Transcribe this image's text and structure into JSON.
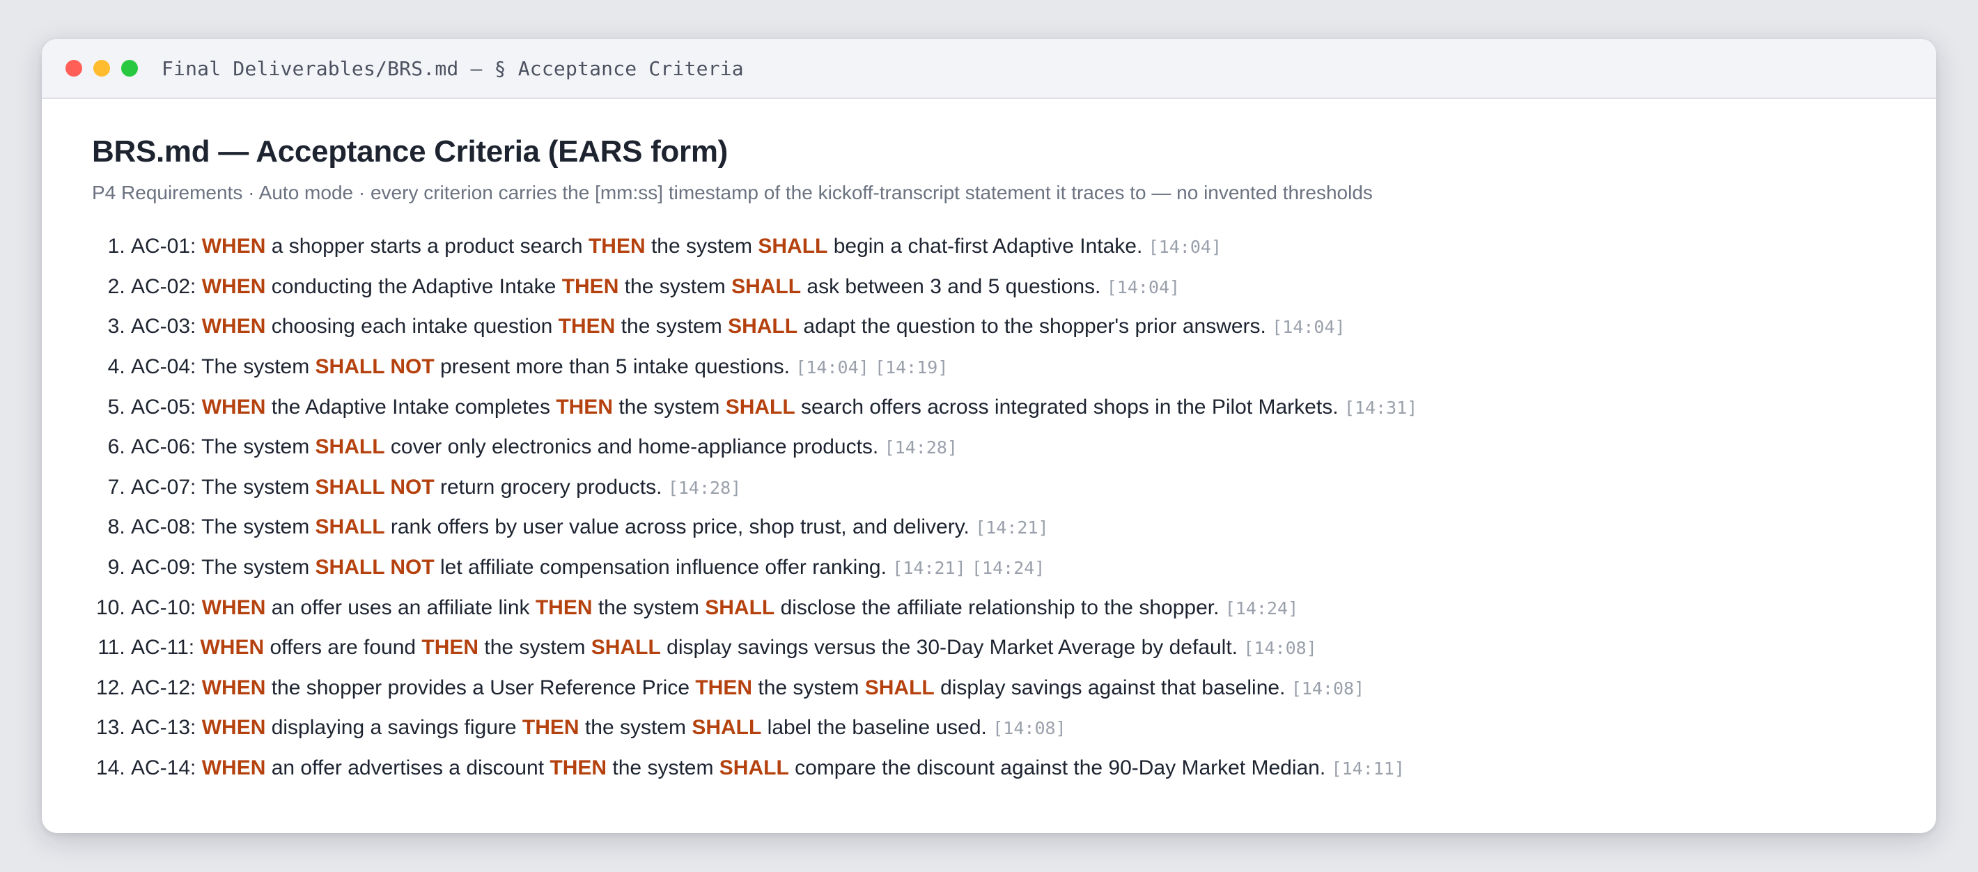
{
  "window": {
    "title": "Final Deliverables/BRS.md — § Acceptance Criteria"
  },
  "page": {
    "title": "BRS.md — Acceptance Criteria (EARS form)",
    "subtitle": "P4 Requirements · Auto mode · every criterion carries the [mm:ss] timestamp of the kickoff-transcript statement it traces to — no invented thresholds"
  },
  "colors": {
    "keyword": "#b5420e",
    "timestamp": "#9aa0ab",
    "text": "#1d2430"
  },
  "criteria": [
    {
      "segments": [
        {
          "t": "AC-01: "
        },
        {
          "t": "WHEN",
          "k": true
        },
        {
          "t": " a shopper starts a product search "
        },
        {
          "t": "THEN",
          "k": true
        },
        {
          "t": " the system "
        },
        {
          "t": "SHALL",
          "k": true
        },
        {
          "t": " begin a chat-first Adaptive Intake."
        }
      ],
      "timestamps": [
        "[14:04]"
      ]
    },
    {
      "segments": [
        {
          "t": "AC-02: "
        },
        {
          "t": "WHEN",
          "k": true
        },
        {
          "t": " conducting the Adaptive Intake "
        },
        {
          "t": "THEN",
          "k": true
        },
        {
          "t": " the system "
        },
        {
          "t": "SHALL",
          "k": true
        },
        {
          "t": " ask between 3 and 5 questions."
        }
      ],
      "timestamps": [
        "[14:04]"
      ]
    },
    {
      "segments": [
        {
          "t": "AC-03: "
        },
        {
          "t": "WHEN",
          "k": true
        },
        {
          "t": " choosing each intake question "
        },
        {
          "t": "THEN",
          "k": true
        },
        {
          "t": " the system "
        },
        {
          "t": "SHALL",
          "k": true
        },
        {
          "t": " adapt the question to the shopper's prior answers."
        }
      ],
      "timestamps": [
        "[14:04]"
      ]
    },
    {
      "segments": [
        {
          "t": "AC-04: The system "
        },
        {
          "t": "SHALL NOT",
          "k": true
        },
        {
          "t": " present more than 5 intake questions."
        }
      ],
      "timestamps": [
        "[14:04]",
        "[14:19]"
      ]
    },
    {
      "segments": [
        {
          "t": "AC-05: "
        },
        {
          "t": "WHEN",
          "k": true
        },
        {
          "t": " the Adaptive Intake completes "
        },
        {
          "t": "THEN",
          "k": true
        },
        {
          "t": " the system "
        },
        {
          "t": "SHALL",
          "k": true
        },
        {
          "t": " search offers across integrated shops in the Pilot Markets."
        }
      ],
      "timestamps": [
        "[14:31]"
      ]
    },
    {
      "segments": [
        {
          "t": "AC-06: The system "
        },
        {
          "t": "SHALL",
          "k": true
        },
        {
          "t": " cover only electronics and home-appliance products."
        }
      ],
      "timestamps": [
        "[14:28]"
      ]
    },
    {
      "segments": [
        {
          "t": "AC-07: The system "
        },
        {
          "t": "SHALL NOT",
          "k": true
        },
        {
          "t": " return grocery products."
        }
      ],
      "timestamps": [
        "[14:28]"
      ]
    },
    {
      "segments": [
        {
          "t": "AC-08: The system "
        },
        {
          "t": "SHALL",
          "k": true
        },
        {
          "t": " rank offers by user value across price, shop trust, and delivery."
        }
      ],
      "timestamps": [
        "[14:21]"
      ]
    },
    {
      "segments": [
        {
          "t": "AC-09: The system "
        },
        {
          "t": "SHALL NOT",
          "k": true
        },
        {
          "t": " let affiliate compensation influence offer ranking."
        }
      ],
      "timestamps": [
        "[14:21]",
        "[14:24]"
      ]
    },
    {
      "segments": [
        {
          "t": "AC-10: "
        },
        {
          "t": "WHEN",
          "k": true
        },
        {
          "t": " an offer uses an affiliate link "
        },
        {
          "t": "THEN",
          "k": true
        },
        {
          "t": " the system "
        },
        {
          "t": "SHALL",
          "k": true
        },
        {
          "t": " disclose the affiliate relationship to the shopper."
        }
      ],
      "timestamps": [
        "[14:24]"
      ]
    },
    {
      "segments": [
        {
          "t": "AC-11: "
        },
        {
          "t": "WHEN",
          "k": true
        },
        {
          "t": " offers are found "
        },
        {
          "t": "THEN",
          "k": true
        },
        {
          "t": " the system "
        },
        {
          "t": "SHALL",
          "k": true
        },
        {
          "t": " display savings versus the 30-Day Market Average by default."
        }
      ],
      "timestamps": [
        "[14:08]"
      ]
    },
    {
      "segments": [
        {
          "t": "AC-12: "
        },
        {
          "t": "WHEN",
          "k": true
        },
        {
          "t": " the shopper provides a User Reference Price "
        },
        {
          "t": "THEN",
          "k": true
        },
        {
          "t": " the system "
        },
        {
          "t": "SHALL",
          "k": true
        },
        {
          "t": " display savings against that baseline."
        }
      ],
      "timestamps": [
        "[14:08]"
      ]
    },
    {
      "segments": [
        {
          "t": "AC-13: "
        },
        {
          "t": "WHEN",
          "k": true
        },
        {
          "t": " displaying a savings figure "
        },
        {
          "t": "THEN",
          "k": true
        },
        {
          "t": " the system "
        },
        {
          "t": "SHALL",
          "k": true
        },
        {
          "t": " label the baseline used."
        }
      ],
      "timestamps": [
        "[14:08]"
      ]
    },
    {
      "segments": [
        {
          "t": "AC-14: "
        },
        {
          "t": "WHEN",
          "k": true
        },
        {
          "t": " an offer advertises a discount "
        },
        {
          "t": "THEN",
          "k": true
        },
        {
          "t": " the system "
        },
        {
          "t": "SHALL",
          "k": true
        },
        {
          "t": " compare the discount against the 90-Day Market Median."
        }
      ],
      "timestamps": [
        "[14:11]"
      ]
    }
  ]
}
